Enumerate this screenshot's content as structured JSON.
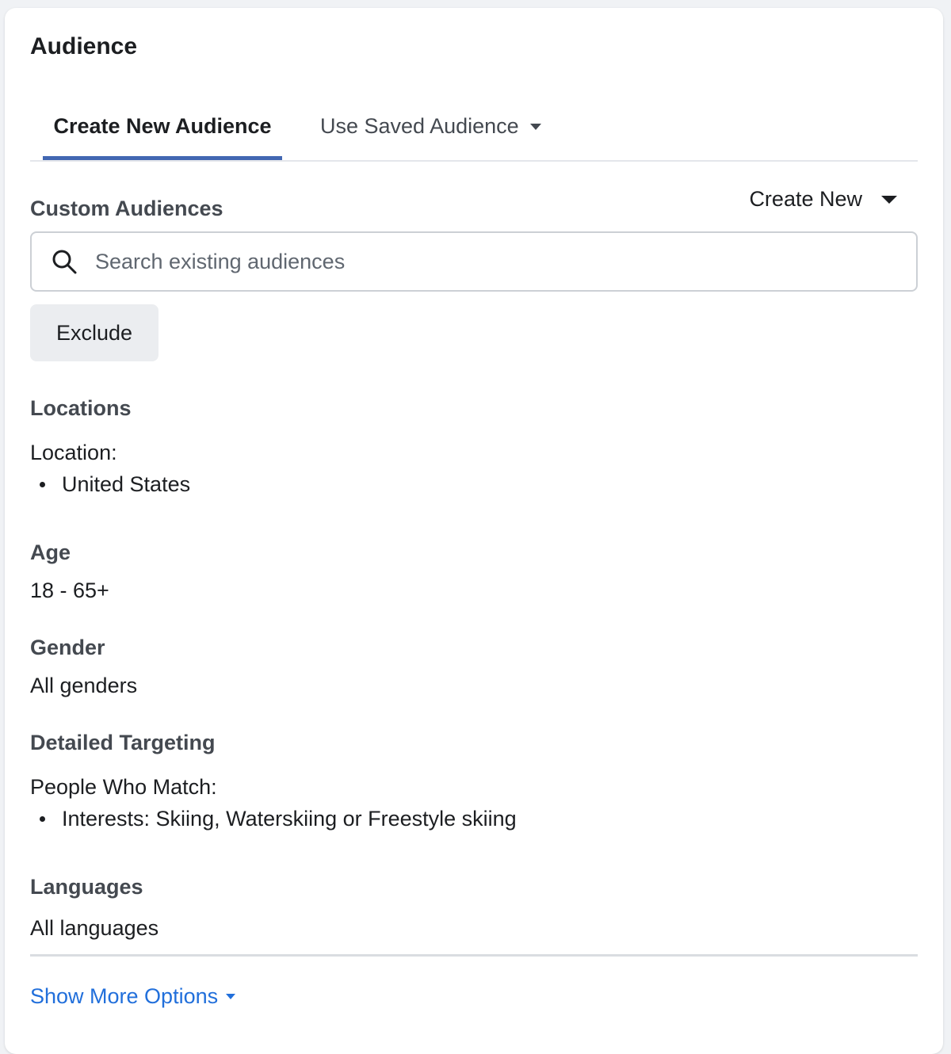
{
  "panel": {
    "title": "Audience"
  },
  "tabs": {
    "create_new": "Create New Audience",
    "use_saved": "Use Saved Audience"
  },
  "custom_audiences": {
    "label": "Custom Audiences",
    "create_new_label": "Create New",
    "search_placeholder": "Search existing audiences",
    "search_value": "",
    "exclude_label": "Exclude"
  },
  "locations": {
    "label": "Locations",
    "sub_label": "Location:",
    "items": [
      "United States"
    ]
  },
  "age": {
    "label": "Age",
    "value": "18 - 65+"
  },
  "gender": {
    "label": "Gender",
    "value": "All genders"
  },
  "detailed_targeting": {
    "label": "Detailed Targeting",
    "sub_label": "People Who Match:",
    "items": [
      "Interests: Skiing, Waterskiing or Freestyle skiing"
    ]
  },
  "languages": {
    "label": "Languages",
    "value": "All languages"
  },
  "footer": {
    "show_more_label": "Show More Options"
  },
  "colors": {
    "accent": "#4267b2",
    "link": "#216fdb",
    "button_bg": "#ebedf0"
  },
  "icons": {
    "search": "search-icon",
    "tab_dropdown": "chevron-down-icon",
    "create_new_dropdown": "caret-down-icon",
    "show_more_dropdown": "caret-down-icon"
  }
}
